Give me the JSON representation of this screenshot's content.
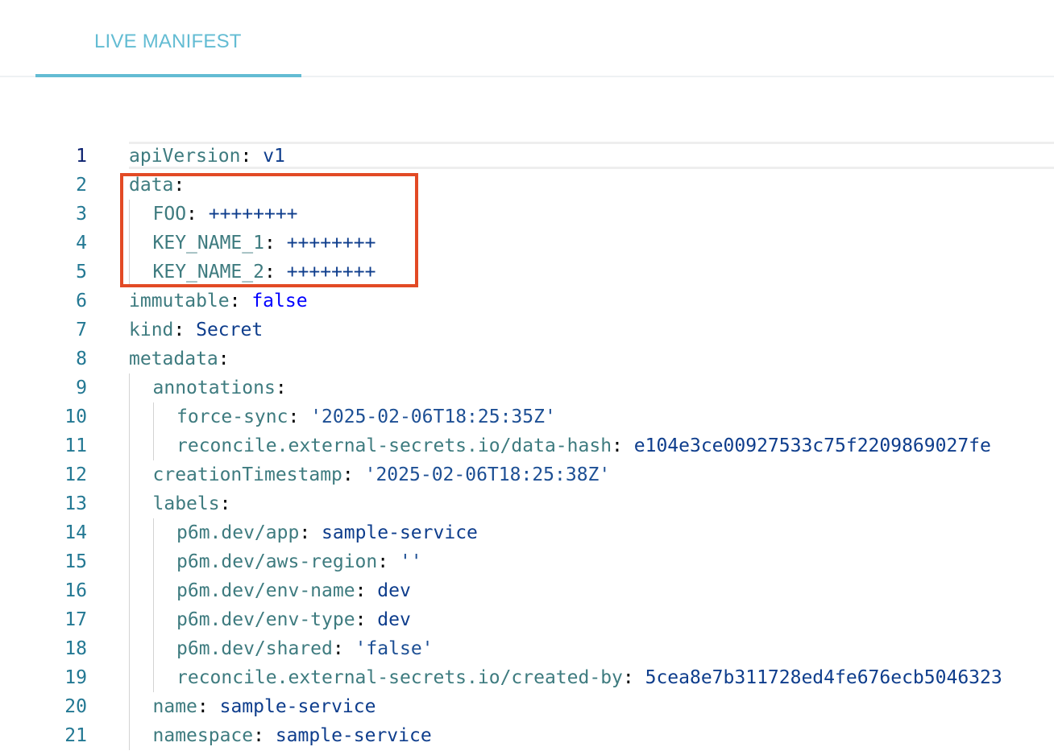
{
  "tab": {
    "label": "LIVE MANIFEST"
  },
  "colors": {
    "accent": "#63bcd3",
    "highlight": "#e24a25",
    "key": "#3e7b7f",
    "string": "#0e3d8c",
    "boolean": "#0000ff",
    "line_number": "#237893"
  },
  "lines": [
    {
      "num": "1",
      "indent": 0,
      "key": "apiVersion",
      "value": "v1",
      "vtype": "s"
    },
    {
      "num": "2",
      "indent": 0,
      "key": "data",
      "value": "",
      "vtype": "s"
    },
    {
      "num": "3",
      "indent": 1,
      "key": "FOO",
      "value": "++++++++",
      "vtype": "s"
    },
    {
      "num": "4",
      "indent": 1,
      "key": "KEY_NAME_1",
      "value": "++++++++",
      "vtype": "s"
    },
    {
      "num": "5",
      "indent": 1,
      "key": "KEY_NAME_2",
      "value": "++++++++",
      "vtype": "s"
    },
    {
      "num": "6",
      "indent": 0,
      "key": "immutable",
      "value": "false",
      "vtype": "b"
    },
    {
      "num": "7",
      "indent": 0,
      "key": "kind",
      "value": "Secret",
      "vtype": "s"
    },
    {
      "num": "8",
      "indent": 0,
      "key": "metadata",
      "value": "",
      "vtype": "s"
    },
    {
      "num": "9",
      "indent": 1,
      "key": "annotations",
      "value": "",
      "vtype": "s"
    },
    {
      "num": "10",
      "indent": 2,
      "key": "force-sync",
      "value": "'2025-02-06T18:25:35Z'",
      "vtype": "q"
    },
    {
      "num": "11",
      "indent": 2,
      "key": "reconcile.external-secrets.io/data-hash",
      "value": "e104e3ce00927533c75f2209869027fe",
      "vtype": "s"
    },
    {
      "num": "12",
      "indent": 1,
      "key": "creationTimestamp",
      "value": "'2025-02-06T18:25:38Z'",
      "vtype": "q"
    },
    {
      "num": "13",
      "indent": 1,
      "key": "labels",
      "value": "",
      "vtype": "s"
    },
    {
      "num": "14",
      "indent": 2,
      "key": "p6m.dev/app",
      "value": "sample-service",
      "vtype": "s"
    },
    {
      "num": "15",
      "indent": 2,
      "key": "p6m.dev/aws-region",
      "value": "''",
      "vtype": "q"
    },
    {
      "num": "16",
      "indent": 2,
      "key": "p6m.dev/env-name",
      "value": "dev",
      "vtype": "s"
    },
    {
      "num": "17",
      "indent": 2,
      "key": "p6m.dev/env-type",
      "value": "dev",
      "vtype": "s"
    },
    {
      "num": "18",
      "indent": 2,
      "key": "p6m.dev/shared",
      "value": "'false'",
      "vtype": "q"
    },
    {
      "num": "19",
      "indent": 2,
      "key": "reconcile.external-secrets.io/created-by",
      "value": "5cea8e7b311728ed4fe676ecb5046323",
      "vtype": "s"
    },
    {
      "num": "20",
      "indent": 1,
      "key": "name",
      "value": "sample-service",
      "vtype": "s"
    },
    {
      "num": "21",
      "indent": 1,
      "key": "namespace",
      "value": "sample-service",
      "vtype": "s"
    }
  ]
}
